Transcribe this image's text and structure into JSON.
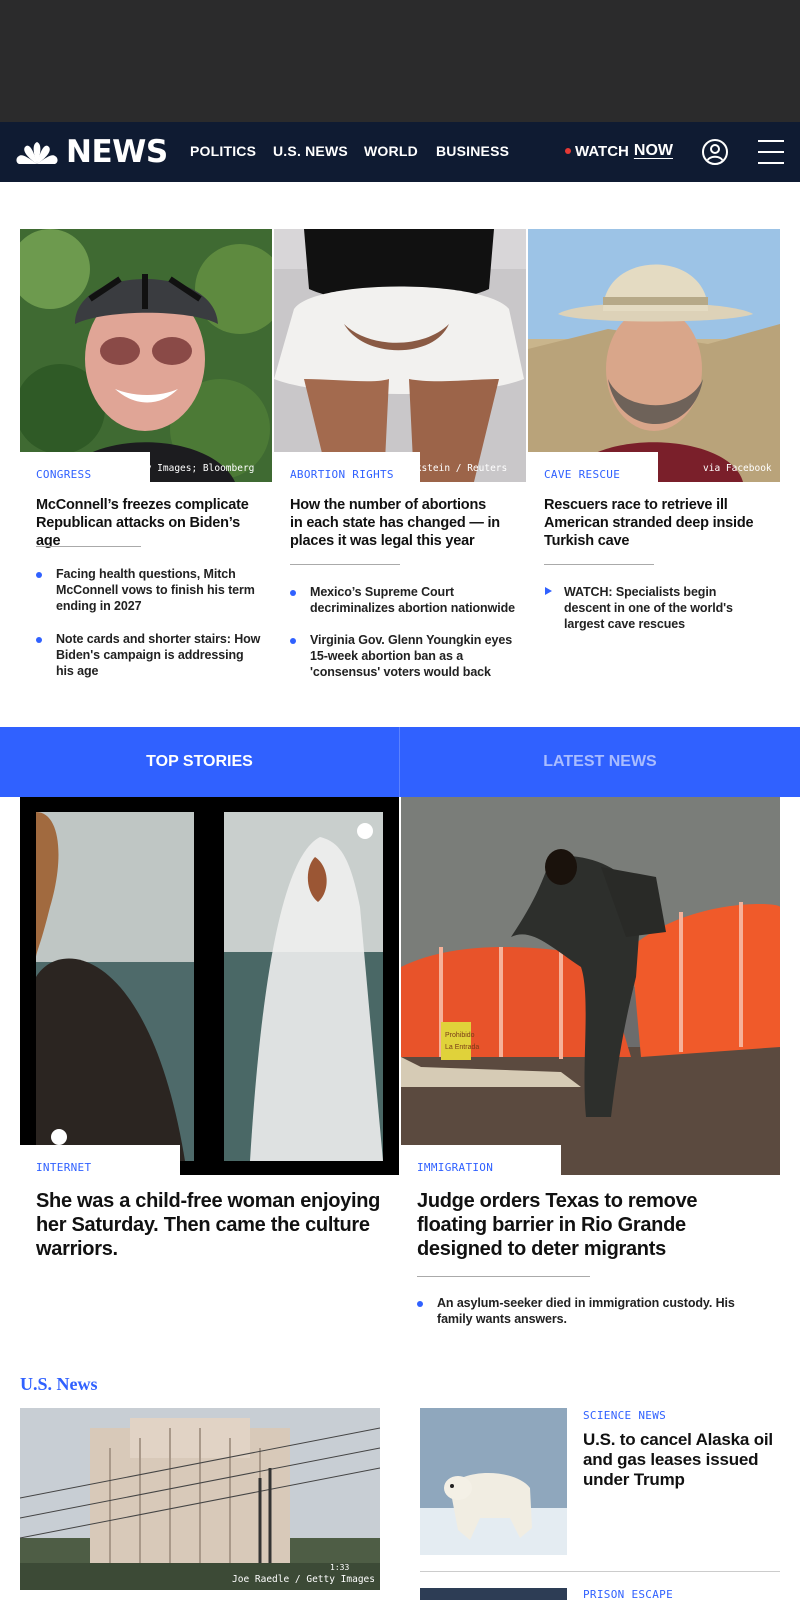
{
  "nav": {
    "logo_text": "NEWS",
    "links": [
      "POLITICS",
      "U.S. NEWS",
      "WORLD",
      "BUSINESS"
    ],
    "watch_label": "WATCH",
    "now_label": "NOW",
    "icons": [
      "peacock-logo-icon",
      "user-icon",
      "menu-icon"
    ]
  },
  "colors": {
    "nav_bg": "#0f1b32",
    "ad_bg": "#2b2b2c",
    "accent": "#3061ff",
    "live_dot": "#e53935"
  },
  "cards": [
    {
      "credit": "ty Images; Bloomberg",
      "label": "CONGRESS",
      "headline": "McConnell’s freezes complicate Republican attacks on Biden’s age",
      "bullets": [
        "Facing health questions, Mitch McConnell vows to finish his term ending in 2027",
        "Note cards and shorter stairs: How Biden's campaign is addressing his age"
      ]
    },
    {
      "credit": "ckstein / Reuters",
      "label": "ABORTION RIGHTS",
      "headline": "How the number of abortions in each state has changed — in places it was legal this year",
      "bullets": [
        "Mexico’s Supreme Court decriminalizes abortion nationwide",
        "Virginia Gov. Glenn Youngkin eyes 15-week abortion ban as a 'consensus' voters would back"
      ]
    },
    {
      "credit": "via Facebook",
      "label": "CAVE RESCUE",
      "headline": "Rescuers race to retrieve ill American stranded deep inside Turkish cave",
      "bullets": [
        "WATCH: Specialists begin descent in one of the world's largest cave rescues"
      ]
    }
  ],
  "tabs": {
    "top_stories": "TOP STORIES",
    "latest_news": "LATEST NEWS"
  },
  "top_stories": [
    {
      "label": "INTERNET",
      "headline": "She was a child-free woman enjoying her Saturday. Then came the culture warriors."
    },
    {
      "label": "IMMIGRATION",
      "headline": "Judge orders Texas to remove floating barrier in Rio Grande designed to deter migrants",
      "bullet": "An asylum-seeker died in immigration custody. His family wants answers.",
      "sign_text_1": "Prohibido",
      "sign_text_2": "La Entrada"
    }
  ],
  "us_news": {
    "title": "U.S. News",
    "main_credit": "Joe Raedle / Getty Images",
    "video_duration": "1:33",
    "side": [
      {
        "label": "SCIENCE NEWS",
        "headline": "U.S. to cancel Alaska oil and gas leases issued under Trump"
      },
      {
        "label": "PRISON ESCAPE"
      }
    ]
  }
}
